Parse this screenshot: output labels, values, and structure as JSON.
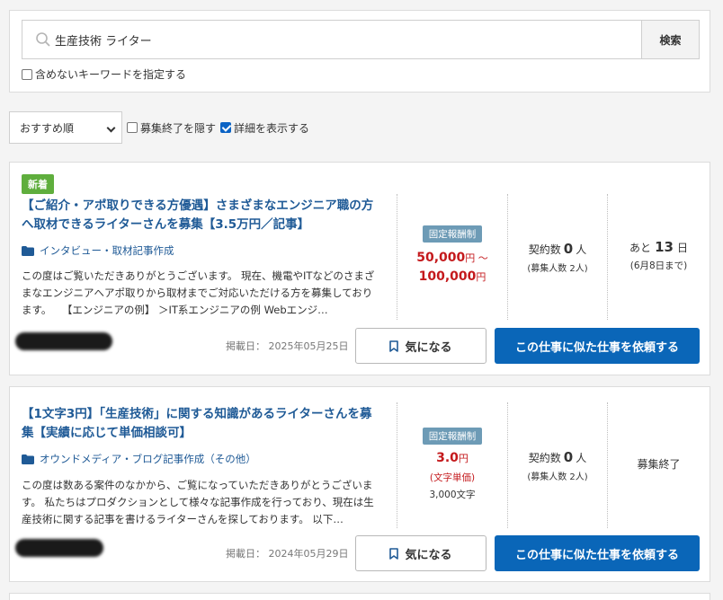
{
  "search": {
    "query": "生産技術 ライター",
    "button_label": "検索",
    "exclude_label": "含めないキーワードを指定する"
  },
  "filters": {
    "sort_selected": "おすすめ順",
    "hide_closed_label": "募集終了を隠す",
    "show_details_label": "詳細を表示する",
    "show_details_checked": true
  },
  "jobs": [
    {
      "badge": "新着",
      "title": "【ご紹介・アポ取りできる方優遇】さまざまなエンジニア職の方へ取材できるライターさんを募集【3.5万円／記事】",
      "category": "インタビュー・取材記事作成",
      "description": "この度はご覧いただきありがとうございます。 現在、機電やITなどのさまざまなエンジニアへアポ取りから取材までご対応いただける方を募集しております。　　【エンジニアの例】 ＞IT系エンジニアの例 Webエンジ…",
      "price_type": "固定報酬制",
      "price_from": "50,000",
      "price_from_unit": "円 〜",
      "price_to": "100,000",
      "price_to_unit": "円",
      "contract_label": "契約数",
      "contract_count": "0",
      "contract_unit": "人",
      "applicants": "(募集人数 2人)",
      "deadline_prefix": "あと",
      "deadline_days": "13",
      "deadline_unit": "日",
      "deadline_date": "(6月8日まで)",
      "posted": "掲載日： 2025年05月25日",
      "fav_label": "気になる",
      "request_label": "この仕事に似た仕事を依頼する"
    },
    {
      "title": "【1文字3円】「生産技術」に関する知識があるライターさんを募集【実績に応じて単価相談可】",
      "category": "オウンドメディア・ブログ記事作成（その他）",
      "description": "この度は数ある案件のなかから、ご覧になっていただきありがとうございます。 私たちはプロダクションとして様々な記事作成を行っており、現在は生産技術に関する記事を書けるライターさんを探しております。 以下…",
      "price_type": "固定報酬制",
      "price": "3.0",
      "price_unit": "円",
      "price_sub": "(文字単価)",
      "price_note": "3,000文字",
      "contract_label": "契約数",
      "contract_count": "0",
      "contract_unit": "人",
      "applicants": "(募集人数 2人)",
      "status": "募集終了",
      "posted": "掲載日： 2024年05月29日",
      "fav_label": "気になる",
      "request_label": "この仕事に似た仕事を依頼する"
    }
  ],
  "icons": [
    "search-icon",
    "folder-icon",
    "bookmark-icon",
    "chevron-down-icon"
  ],
  "colors": {
    "title_link": "#1f5a96",
    "price_red": "#c4191c",
    "primary_button": "#0a66b8",
    "new_badge": "#5fae3d",
    "price_badge": "#6d9bb6"
  }
}
